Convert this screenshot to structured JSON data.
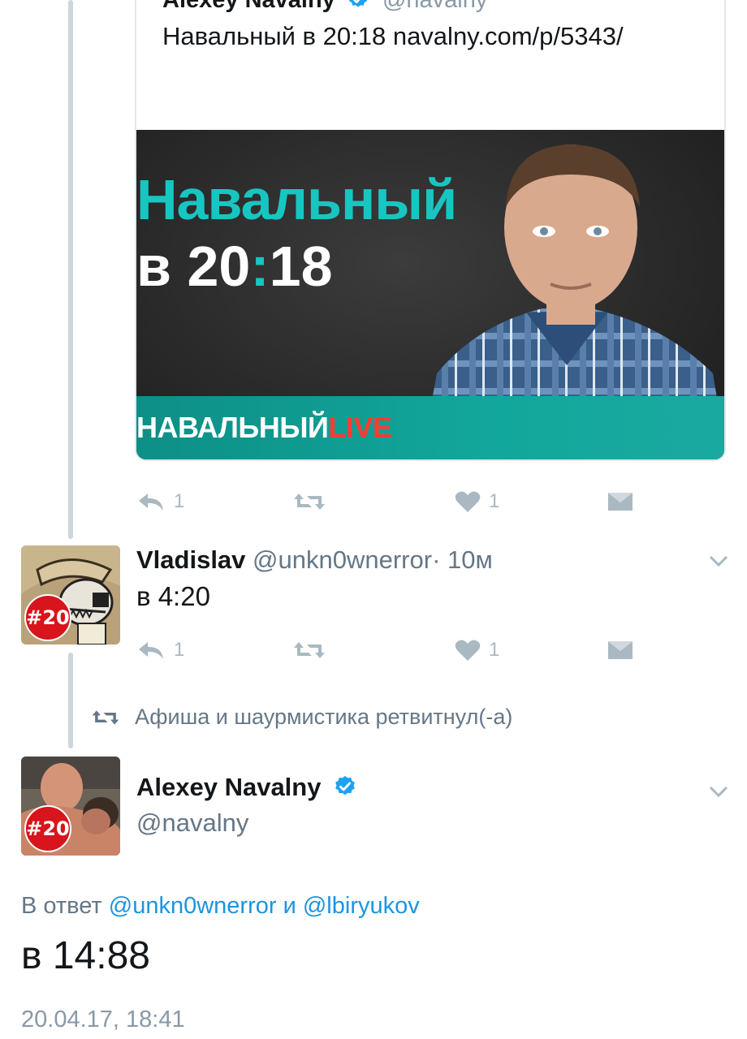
{
  "quoted_tweet": {
    "name": "Alexey Navalny",
    "handle": "@navalny",
    "text": "Навальный в 20:18 navalny.com/p/5343/",
    "media": {
      "title_line1": "Навальный",
      "title_line2_prefix": "в 20",
      "title_line2_colon": ":",
      "title_line2_suffix": "18",
      "brand_main": "НАВАЛЬНЫЙ",
      "brand_live": "LIVE"
    },
    "actions": {
      "reply_count": "1",
      "like_count": "1"
    }
  },
  "reply_tweet": {
    "name": "Vladislav",
    "handle": "@unkn0wnerror",
    "time": "· 10м",
    "text": "в 4:20",
    "badge": "#20",
    "actions": {
      "reply_count": "1",
      "like_count": "1"
    }
  },
  "retweet_notice": {
    "text": "Афиша и шаурмистика ретвитнул(-а)"
  },
  "main_tweet": {
    "name": "Alexey Navalny",
    "handle": "@navalny",
    "badge": "#20",
    "reply_prefix": "В ответ",
    "reply_user1": "@unkn0wnerror",
    "reply_and": "и",
    "reply_user2": "@lbiryukov",
    "text": "в 14:88",
    "timestamp": "20.04.17, 18:41"
  },
  "colors": {
    "accent": "#1b95e0",
    "teal": "#17c6c1",
    "badge": "#d8141c",
    "icon": "#aab8c2"
  }
}
